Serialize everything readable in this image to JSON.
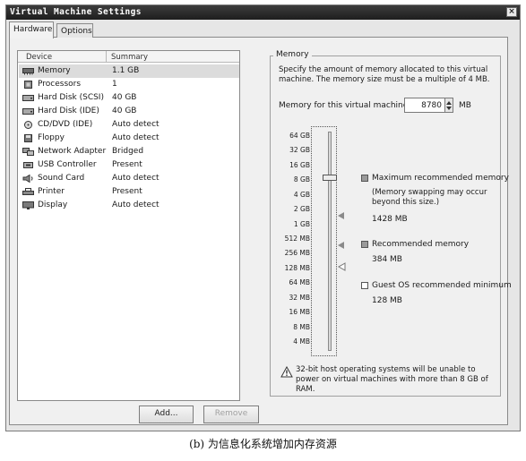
{
  "window": {
    "title": "Virtual Machine Settings",
    "close_glyph": "×"
  },
  "tabs": [
    {
      "label": "Hardware"
    },
    {
      "label": "Options"
    }
  ],
  "device_list": {
    "columns": {
      "device": "Device",
      "summary": "Summary"
    },
    "rows": [
      {
        "name": "Memory",
        "summary": "1.1 GB",
        "icon": "memory-icon"
      },
      {
        "name": "Processors",
        "summary": "1",
        "icon": "processor-icon"
      },
      {
        "name": "Hard Disk (SCSI)",
        "summary": "40 GB",
        "icon": "hard-disk-icon"
      },
      {
        "name": "Hard Disk (IDE)",
        "summary": "40 GB",
        "icon": "hard-disk-icon"
      },
      {
        "name": "CD/DVD (IDE)",
        "summary": "Auto detect",
        "icon": "cd-dvd-icon"
      },
      {
        "name": "Floppy",
        "summary": "Auto detect",
        "icon": "floppy-icon"
      },
      {
        "name": "Network Adapter",
        "summary": "Bridged",
        "icon": "network-adapter-icon"
      },
      {
        "name": "USB Controller",
        "summary": "Present",
        "icon": "usb-icon"
      },
      {
        "name": "Sound Card",
        "summary": "Auto detect",
        "icon": "sound-card-icon"
      },
      {
        "name": "Printer",
        "summary": "Present",
        "icon": "printer-icon"
      },
      {
        "name": "Display",
        "summary": "Auto detect",
        "icon": "display-icon"
      }
    ]
  },
  "buttons": {
    "add": "Add...",
    "remove": "Remove"
  },
  "memory": {
    "group_title": "Memory",
    "description": "Specify the amount of memory allocated to this virtual machine. The memory size must be a multiple of 4 MB.",
    "field_label": "Memory for this virtual machine:",
    "value": "8780",
    "unit": "MB",
    "scale": [
      "64 GB",
      "32 GB",
      "16 GB",
      "8 GB",
      "4 GB",
      "2 GB",
      "1 GB",
      "512 MB",
      "256 MB",
      "128 MB",
      "64 MB",
      "32 MB",
      "16 MB",
      "8 MB",
      "4 MB"
    ],
    "legend": {
      "max": {
        "title": "Maximum recommended memory",
        "note": "(Memory swapping may occur beyond this size.)",
        "value": "1428 MB"
      },
      "recommended": {
        "title": "Recommended memory",
        "value": "384 MB"
      },
      "minimum": {
        "title": "Guest OS recommended minimum",
        "value": "128 MB"
      }
    },
    "warning": "32-bit host operating systems will be unable to power on virtual machines with more than 8 GB of RAM."
  },
  "caption": "(b) 为信息化系统增加内存资源"
}
